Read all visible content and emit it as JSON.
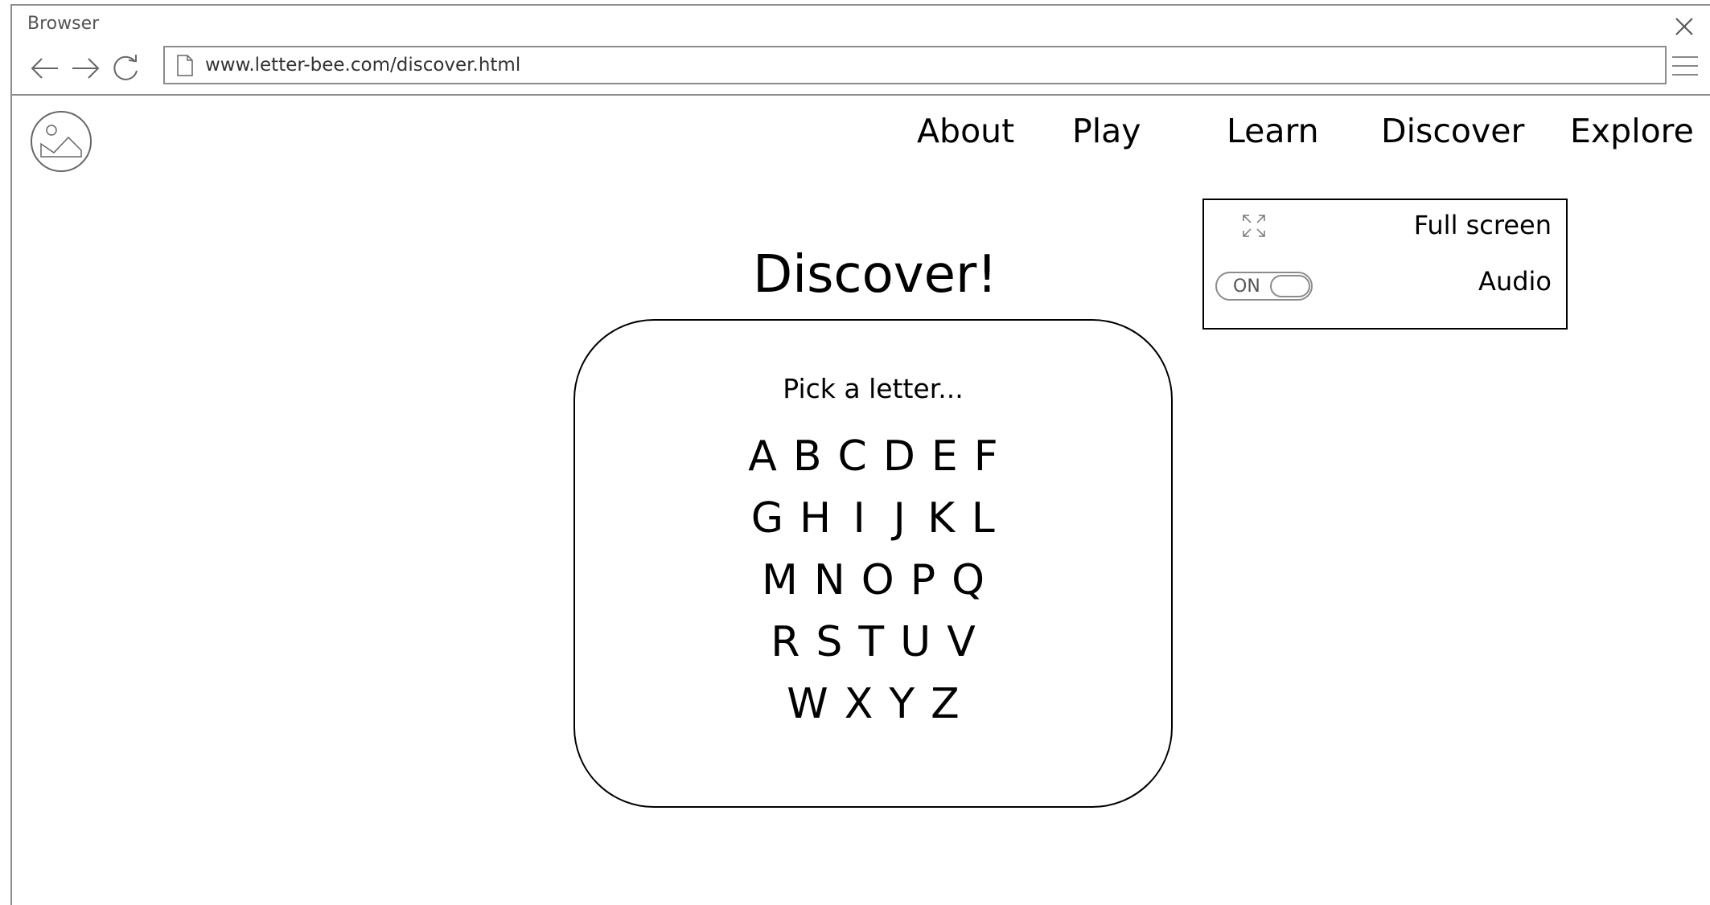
{
  "browser": {
    "window_title": "Browser",
    "url": "www.letter-bee.com/discover.html"
  },
  "nav": {
    "items": [
      {
        "label": "About"
      },
      {
        "label": "Play"
      },
      {
        "label": "Learn"
      },
      {
        "label": "Discover"
      },
      {
        "label": "Explore"
      }
    ]
  },
  "page": {
    "title": "Discover!"
  },
  "settings": {
    "fullscreen_label": "Full screen",
    "audio_label": "Audio",
    "audio_toggle_text": "ON"
  },
  "letter_picker": {
    "prompt": "Pick a letter...",
    "rows": [
      [
        "A",
        "B",
        "C",
        "D",
        "E",
        "F"
      ],
      [
        "G",
        "H",
        "I",
        "J",
        "K",
        "L"
      ],
      [
        "M",
        "N",
        "O",
        "P",
        "Q"
      ],
      [
        "R",
        "S",
        "T",
        "U",
        "V"
      ],
      [
        "W",
        "X",
        "Y",
        "Z"
      ]
    ]
  },
  "icons": {
    "logo": "image-placeholder-icon",
    "back": "back-arrow-icon",
    "forward": "forward-arrow-icon",
    "reload": "reload-icon",
    "page": "file-icon",
    "menu": "hamburger-menu-icon",
    "close": "close-icon",
    "fullscreen": "fullscreen-icon"
  }
}
